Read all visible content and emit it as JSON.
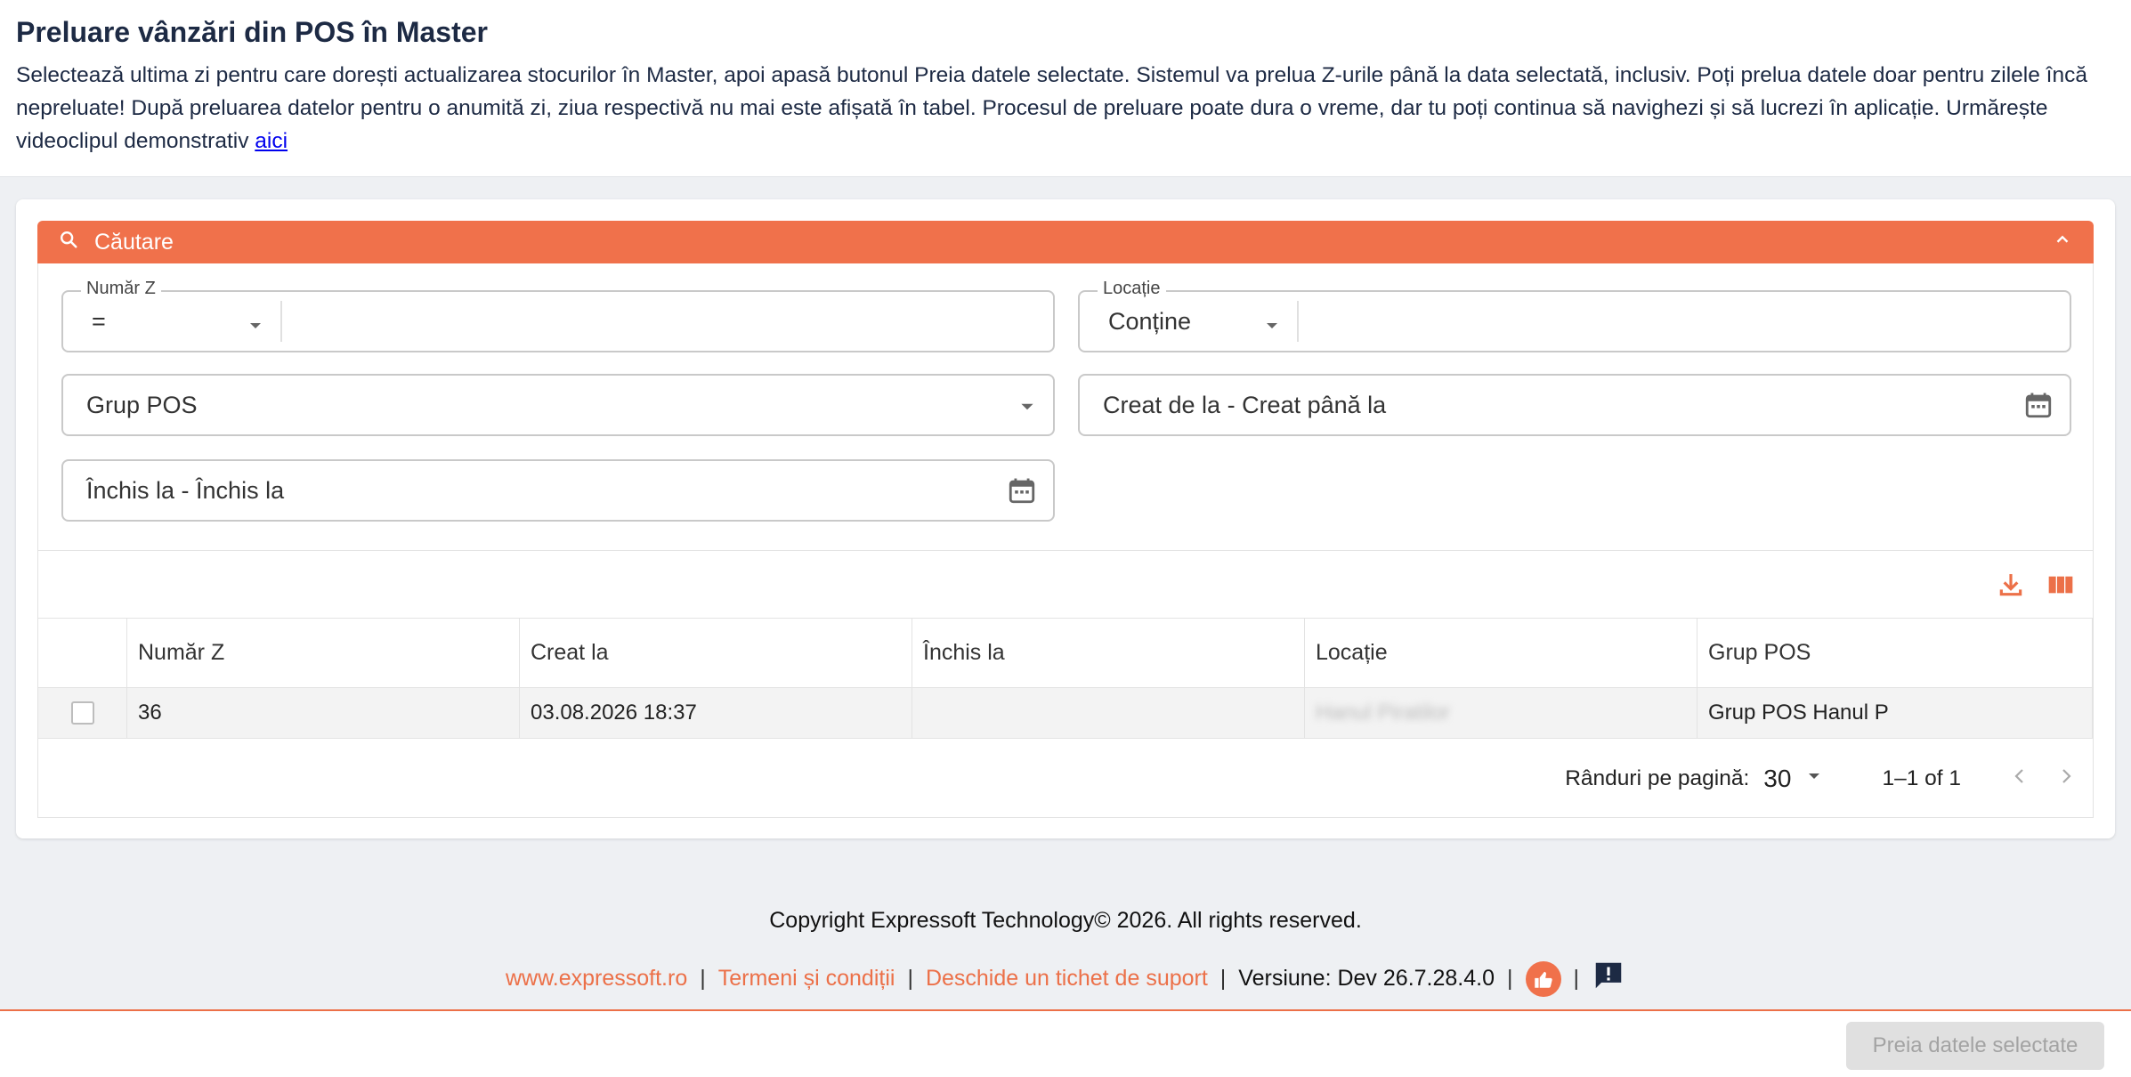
{
  "page": {
    "title": "Preluare vânzări din POS în Master",
    "description_text": "Selectează ultima zi pentru care dorești actualizarea stocurilor în Master, apoi apasă butonul Preia datele selectate. Sistemul va prelua Z-urile până la data selectată, inclusiv. Poți prelua datele doar pentru zilele încă nepreluate! După preluarea datelor pentru o anumită zi, ziua respectivă nu mai este afișată în tabel. Procesul de preluare poate dura o vreme, dar tu poți continua să navighezi și să lucrezi în aplicație. Urmărește videoclipul demonstrativ",
    "description_link": "aici"
  },
  "search": {
    "header_label": "Căutare",
    "header_icon": "search-icon",
    "collapse_icon": "chevron-up-icon",
    "numar_z": {
      "label": "Număr Z",
      "operator": "=",
      "value": ""
    },
    "locatie": {
      "label": "Locație",
      "operator": "Conține",
      "value": ""
    },
    "grup_pos": {
      "placeholder": "Grup POS"
    },
    "creat": {
      "placeholder": "Creat de la - Creat până la"
    },
    "inchis": {
      "placeholder": "Închis la - Închis la"
    }
  },
  "toolbar": {
    "export_icon": "download-icon",
    "columns_icon": "columns-icon"
  },
  "table": {
    "columns": [
      "Număr Z",
      "Creat la",
      "Închis la",
      "Locație",
      "Grup POS"
    ],
    "rows": [
      {
        "numar_z": "36",
        "creat_la": "03.08.2026 18:37",
        "inchis_la": "",
        "locatie": "Hanul Piratilor",
        "grup_pos": "Grup POS Hanul P"
      }
    ]
  },
  "pagination": {
    "rows_per_page_label": "Rânduri pe pagină:",
    "rows_per_page_value": "30",
    "range": "1–1 of 1"
  },
  "footer": {
    "copyright": "Copyright Expressoft Technology© 2026. All rights reserved.",
    "link_site": "www.expressoft.ro",
    "link_terms": "Termeni și condiții",
    "link_ticket": "Deschide un tichet de suport",
    "version": "Versiune: Dev 26.7.28.4.0",
    "separator": "|"
  },
  "actions": {
    "submit_label": "Preia datele selectate"
  },
  "colors": {
    "accent": "#f0714b",
    "link_orange": "#ec7048",
    "title": "#1d2a44"
  }
}
